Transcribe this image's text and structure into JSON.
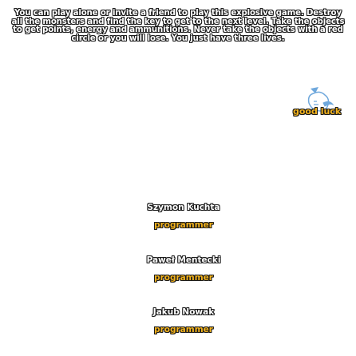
{
  "instructions": "You can play alone or invite a friend to play this explosive game. Destroy all the monsters and find the key to get to the next level. Take the objects to get points, energy and ammunitions. Never take the objects with a red circle or you will lose. You just have three lives.",
  "good_luck": "good luck",
  "credits": [
    {
      "name": "Szymon Kuchta",
      "role": "programmer"
    },
    {
      "name": "Paweł Mentecki",
      "role": "programmer"
    },
    {
      "name": "Jakub Nowak",
      "role": "programmer"
    }
  ],
  "colors": {
    "accent": "#f2b21c",
    "outline": "#1a1a1a",
    "mascot": "#6fa8dc"
  }
}
